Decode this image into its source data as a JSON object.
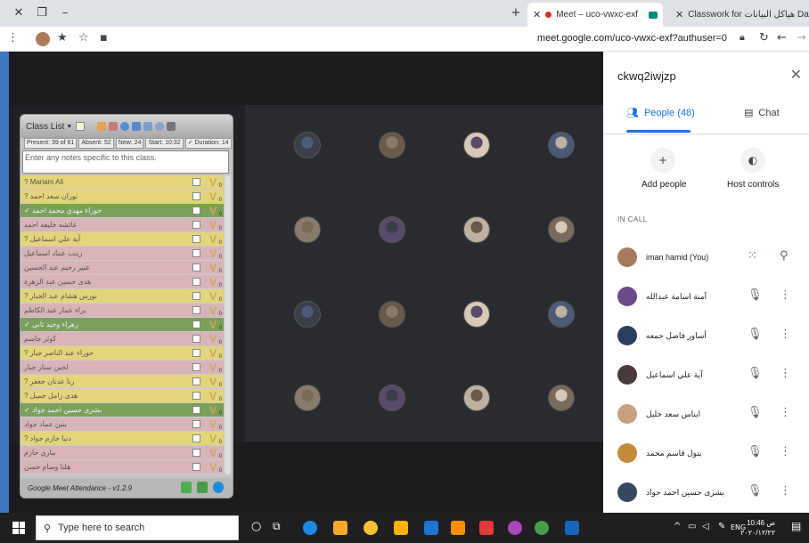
{
  "browser": {
    "tabs": [
      {
        "label": "Meet – uco-vwxc-exf",
        "active": true
      },
      {
        "label": "Classwork for هياكل البيانات Data",
        "active": false
      }
    ],
    "url": "meet.google.com/uco-vwxc-exf?authuser=0"
  },
  "classlist": {
    "title": "Class List",
    "stats": {
      "present": "Present: 39 of 61",
      "absent": "Absent: 52",
      "new": "New: 24",
      "start": "Start: 10:32",
      "duration": "✓ Duration: 14"
    },
    "notes_placeholder": "Enter any notes specific to this class.",
    "rows": [
      {
        "name": "? Mariam Ali",
        "status": "y",
        "count": "0"
      },
      {
        "name": "? نوران سعد احمد",
        "status": "y",
        "count": "0"
      },
      {
        "name": "✓ حوراء مهدي محمد احمد",
        "status": "g",
        "count": "0"
      },
      {
        "name": "عائشه خليفه احمد",
        "status": "p",
        "count": "0"
      },
      {
        "name": "? آية علي اسماعيل",
        "status": "y",
        "count": "0"
      },
      {
        "name": "زينب عماد اسماعيل",
        "status": "p",
        "count": "0"
      },
      {
        "name": "عبير رحيم عبد الحسين",
        "status": "p",
        "count": "0"
      },
      {
        "name": "هدى حسين عبد الزهرة",
        "status": "p",
        "count": "0"
      },
      {
        "name": "? نورس هشام عبد الجبار",
        "status": "y",
        "count": "0"
      },
      {
        "name": "براء عمار عبد الكاظم",
        "status": "p",
        "count": "0"
      },
      {
        "name": "✓ زهراء وحيد ثاني",
        "status": "g",
        "count": "0"
      },
      {
        "name": "كوثر جاسم",
        "status": "p",
        "count": "0"
      },
      {
        "name": "? حوراء عبد الناصر جبار",
        "status": "y",
        "count": "0"
      },
      {
        "name": "لجين ستار جبار",
        "status": "p",
        "count": "0"
      },
      {
        "name": "? رنا عدنان جعفر",
        "status": "y",
        "count": "0"
      },
      {
        "name": "? هدى زامل جميل",
        "status": "y",
        "count": "0"
      },
      {
        "name": "✓ بشرى حسين احمد جواد",
        "status": "g",
        "count": "0"
      },
      {
        "name": "بنين عماد جواد",
        "status": "p",
        "count": "0"
      },
      {
        "name": "? دنيا حازم جواد",
        "status": "y",
        "count": "0"
      },
      {
        "name": "ماري حازم",
        "status": "p",
        "count": "0"
      },
      {
        "name": "هلنا وسام حسن",
        "status": "p",
        "count": "0"
      }
    ],
    "footer": "Google Meet Attendance - v1.2.9"
  },
  "panel": {
    "meeting_title": "ckwq2iwjzp",
    "tab_people": "People (48)",
    "tab_chat": "Chat",
    "add_people": "Add people",
    "host_controls": "Host controls",
    "in_call": "IN CALL",
    "participants": [
      {
        "name": "iman hamid (You)"
      },
      {
        "name": "آمنة اسامة عبدالله"
      },
      {
        "name": "أساور فاضل جمعه"
      },
      {
        "name": "آية علي اسماعيل"
      },
      {
        "name": "ايناس سعد خليل"
      },
      {
        "name": "بتول قاسم محمد"
      },
      {
        "name": "بشرى حسين احمد جواد"
      }
    ]
  },
  "taskbar": {
    "search_placeholder": "Type here to search",
    "language": "ENG",
    "time": "10:46 ص",
    "date": "٢٠٢٠/١٢/٢٢"
  }
}
